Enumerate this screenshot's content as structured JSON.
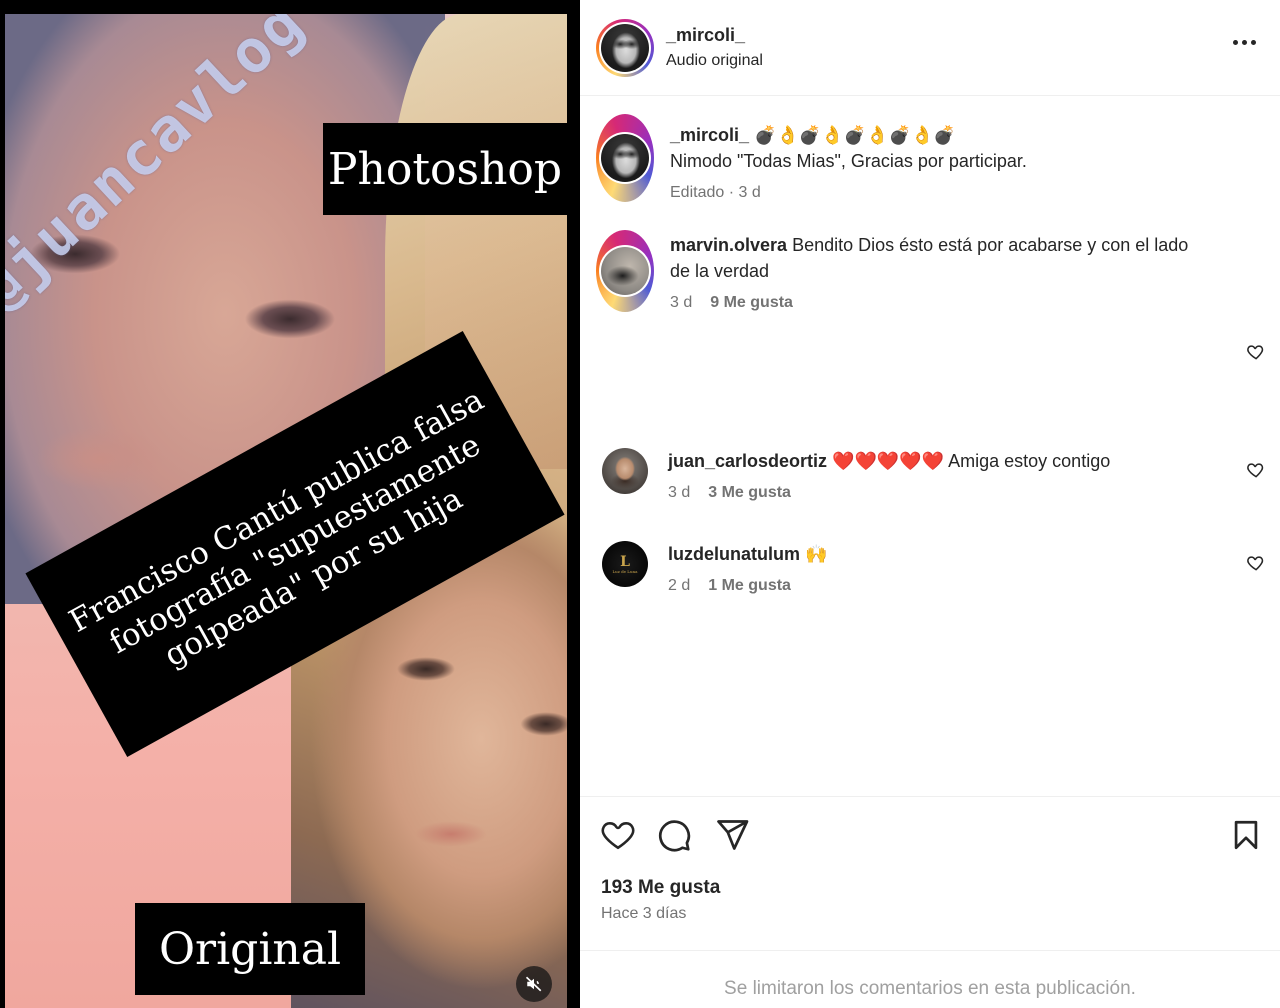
{
  "media": {
    "watermark": "@juancavlog",
    "label_top": "Photoshop",
    "label_bottom": "Original",
    "caption_lines": [
      "Francisco Cantú publica falsa",
      "fotografía \"supuestamente",
      "golpeada\" por su hija"
    ],
    "mute_icon": "speaker-muted-icon"
  },
  "header": {
    "username": "_mircoli_",
    "subtitle": "Audio original",
    "more_icon": "more-options-icon"
  },
  "caption_comment": {
    "username": "_mircoli_",
    "emojis": "💣👌💣👌💣👌💣👌💣",
    "text": "Nimodo \"Todas Mias\", Gracias por participar.",
    "meta": "Editado · 3 d"
  },
  "comments": [
    {
      "username": "marvin.olvera",
      "text": "Bendito Dios ésto está por acabarse y con el lado de la verdad",
      "time": "3 d",
      "likes": "9 Me gusta"
    },
    {
      "username": "juan_carlosdeortiz",
      "text": "❤️❤️❤️❤️❤️ Amiga estoy contigo",
      "time": "3 d",
      "likes": "3 Me gusta"
    },
    {
      "username": "luzdelunatulum",
      "text": "🙌",
      "time": "2 d",
      "likes": "1 Me gusta"
    }
  ],
  "actions": {
    "like_icon": "heart-icon",
    "comment_icon": "comment-icon",
    "share_icon": "send-icon",
    "save_icon": "bookmark-icon",
    "likes_count": "193 Me gusta",
    "posted": "Hace 3 días"
  },
  "footer": {
    "notice": "Se limitaron los comentarios en esta publicación."
  },
  "colors": {
    "text": "#262626",
    "secondary": "#737373",
    "divider": "#efefef",
    "story_ring": [
      "#feda75",
      "#fa7e1e",
      "#d62976",
      "#962fbf",
      "#4f5bd5"
    ]
  }
}
